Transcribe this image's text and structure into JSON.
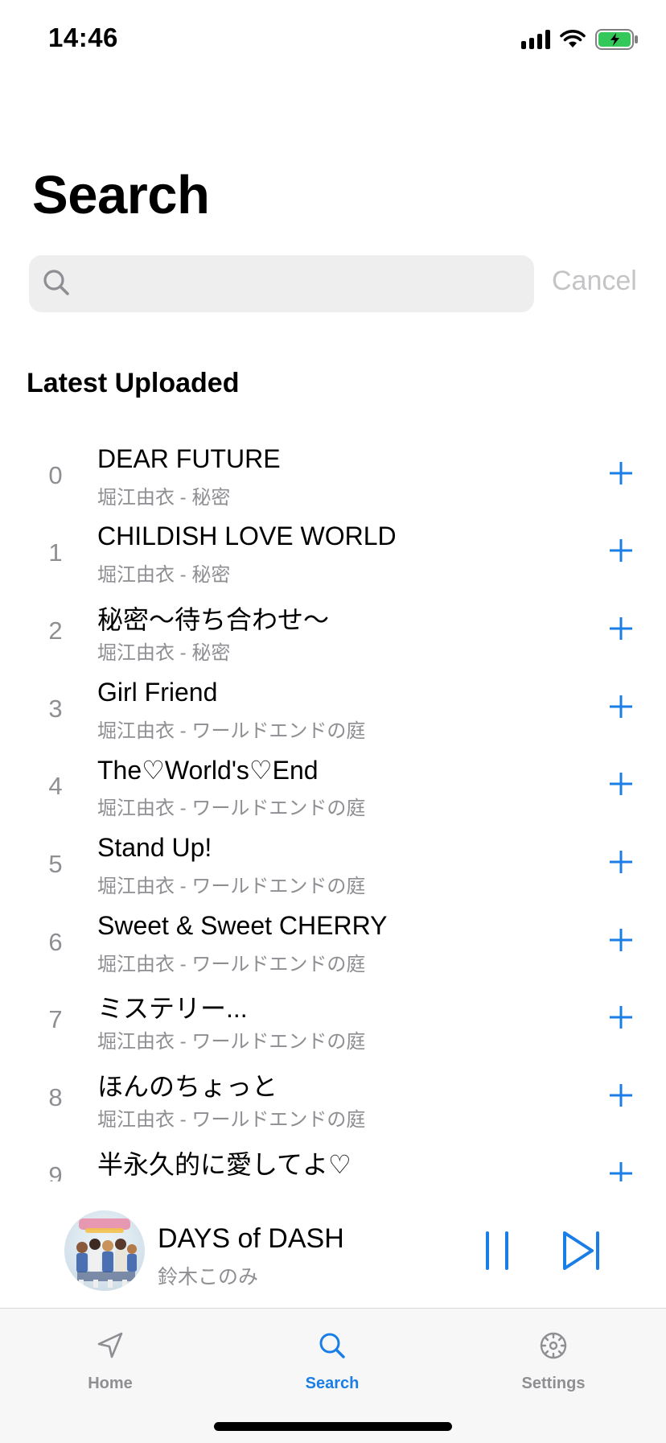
{
  "status_bar": {
    "time": "14:46"
  },
  "page": {
    "title": "Search"
  },
  "search": {
    "placeholder": "",
    "value": "",
    "cancel_label": "Cancel"
  },
  "section": {
    "title": "Latest Uploaded"
  },
  "tracks": [
    {
      "index": "0",
      "title": "DEAR FUTURE",
      "subtitle": "堀江由衣 - 秘密"
    },
    {
      "index": "1",
      "title": "CHILDISH LOVE WORLD",
      "subtitle": "堀江由衣 - 秘密"
    },
    {
      "index": "2",
      "title": "秘密～待ち合わせ～",
      "subtitle": "堀江由衣 - 秘密"
    },
    {
      "index": "3",
      "title": "Girl Friend",
      "subtitle": "堀江由衣 - ワールドエンドの庭"
    },
    {
      "index": "4",
      "title": "The♡World's♡End",
      "subtitle": "堀江由衣 - ワールドエンドの庭"
    },
    {
      "index": "5",
      "title": "Stand Up!",
      "subtitle": "堀江由衣 - ワールドエンドの庭"
    },
    {
      "index": "6",
      "title": "Sweet & Sweet CHERRY",
      "subtitle": "堀江由衣 - ワールドエンドの庭"
    },
    {
      "index": "7",
      "title": "ミステリー...",
      "subtitle": "堀江由衣 - ワールドエンドの庭"
    },
    {
      "index": "8",
      "title": "ほんのちょっと",
      "subtitle": "堀江由衣 - ワールドエンドの庭"
    },
    {
      "index": "9",
      "title": "半永久的に愛してよ♡",
      "subtitle": ""
    }
  ],
  "now_playing": {
    "title": "DAYS of DASH",
    "artist": "鈴木このみ"
  },
  "tabs": [
    {
      "label": "Home",
      "icon": "location-arrow-icon",
      "active": false
    },
    {
      "label": "Search",
      "icon": "search-icon",
      "active": true
    },
    {
      "label": "Settings",
      "icon": "gear-icon",
      "active": false
    }
  ],
  "colors": {
    "accent": "#1a7ee6",
    "secondary_text": "#8e8e93",
    "search_bg": "#eeeeee",
    "battery": "#34c759"
  }
}
